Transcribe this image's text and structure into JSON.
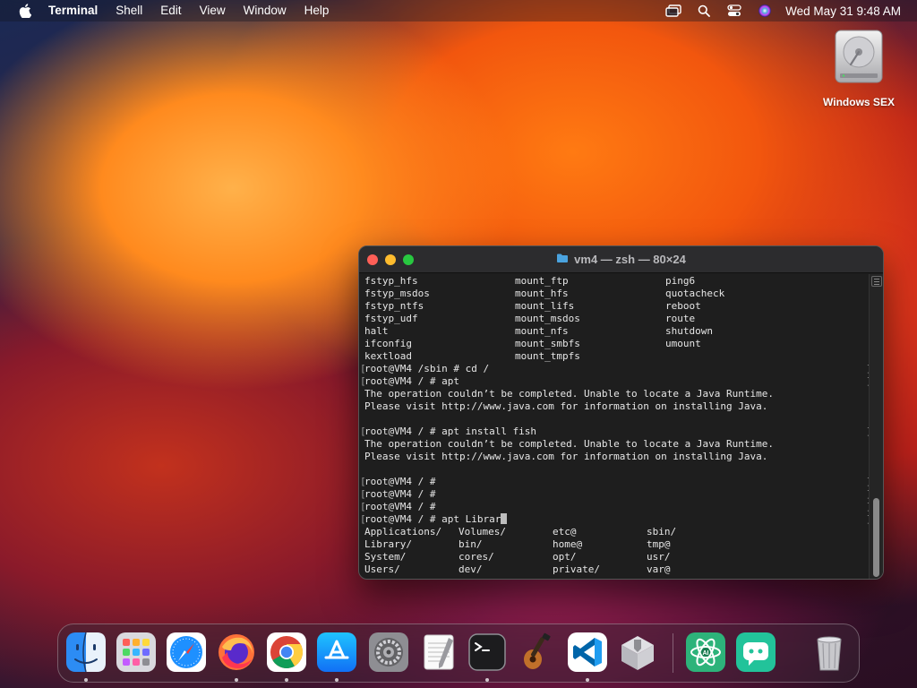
{
  "menubar": {
    "app_name": "Terminal",
    "menus": [
      "Shell",
      "Edit",
      "View",
      "Window",
      "Help"
    ],
    "clock": "Wed May 31  9:48 AM",
    "status_icons": [
      "window-mirror-icon",
      "search-icon",
      "control-center-icon",
      "siri-icon"
    ]
  },
  "desktop": {
    "icon_label": "Windows SEX",
    "icon_name": "hard-drive-icon"
  },
  "terminal": {
    "title": "vm4 — zsh — 80×24",
    "columns_block": [
      [
        "fstyp_hfs",
        "mount_ftp",
        "ping6"
      ],
      [
        "fstyp_msdos",
        "mount_hfs",
        "quotacheck"
      ],
      [
        "fstyp_ntfs",
        "mount_lifs",
        "reboot"
      ],
      [
        "fstyp_udf",
        "mount_msdos",
        "route"
      ],
      [
        "halt",
        "mount_nfs",
        "shutdown"
      ],
      [
        "ifconfig",
        "mount_smbfs",
        "umount"
      ],
      [
        "kextload",
        "mount_tmpfs",
        ""
      ]
    ],
    "lines": [
      {
        "text": "root@VM4 /sbin # cd /",
        "prompt": true
      },
      {
        "text": "root@VM4 / # apt",
        "prompt": true
      },
      {
        "text": "The operation couldn’t be completed. Unable to locate a Java Runtime.",
        "prompt": false
      },
      {
        "text": "Please visit http://www.java.com for information on installing Java.",
        "prompt": false
      },
      {
        "text": "",
        "prompt": false
      },
      {
        "text": "root@VM4 / # apt install fish",
        "prompt": true
      },
      {
        "text": "The operation couldn’t be completed. Unable to locate a Java Runtime.",
        "prompt": false
      },
      {
        "text": "Please visit http://www.java.com for information on installing Java.",
        "prompt": false
      },
      {
        "text": "",
        "prompt": false
      },
      {
        "text": "root@VM4 / #",
        "prompt": true
      },
      {
        "text": "root@VM4 / #",
        "prompt": true
      },
      {
        "text": "root@VM4 / #",
        "prompt": true
      }
    ],
    "current_line": "root@VM4 / # apt Librar",
    "completions": [
      [
        "Applications/",
        "Volumes/",
        "etc@",
        "sbin/"
      ],
      [
        "Library/",
        "bin/",
        "home@",
        "tmp@"
      ],
      [
        "System/",
        "cores/",
        "opt/",
        "usr/"
      ],
      [
        "Users/",
        "dev/",
        "private/",
        "var@"
      ]
    ]
  },
  "dock": {
    "apps": [
      {
        "name": "finder",
        "running": true
      },
      {
        "name": "launchpad",
        "running": false
      },
      {
        "name": "safari",
        "running": false
      },
      {
        "name": "firefox",
        "running": true
      },
      {
        "name": "chrome",
        "running": true
      },
      {
        "name": "app-store",
        "running": true
      },
      {
        "name": "system-settings",
        "running": false
      },
      {
        "name": "textedit",
        "running": false
      },
      {
        "name": "terminal",
        "running": true
      },
      {
        "name": "garageband",
        "running": false
      },
      {
        "name": "vscode",
        "running": true
      },
      {
        "name": "installer",
        "running": false
      },
      {
        "name": "ai-atom",
        "running": false
      },
      {
        "name": "chatbot",
        "running": false
      },
      {
        "name": "trash",
        "running": false
      }
    ]
  }
}
